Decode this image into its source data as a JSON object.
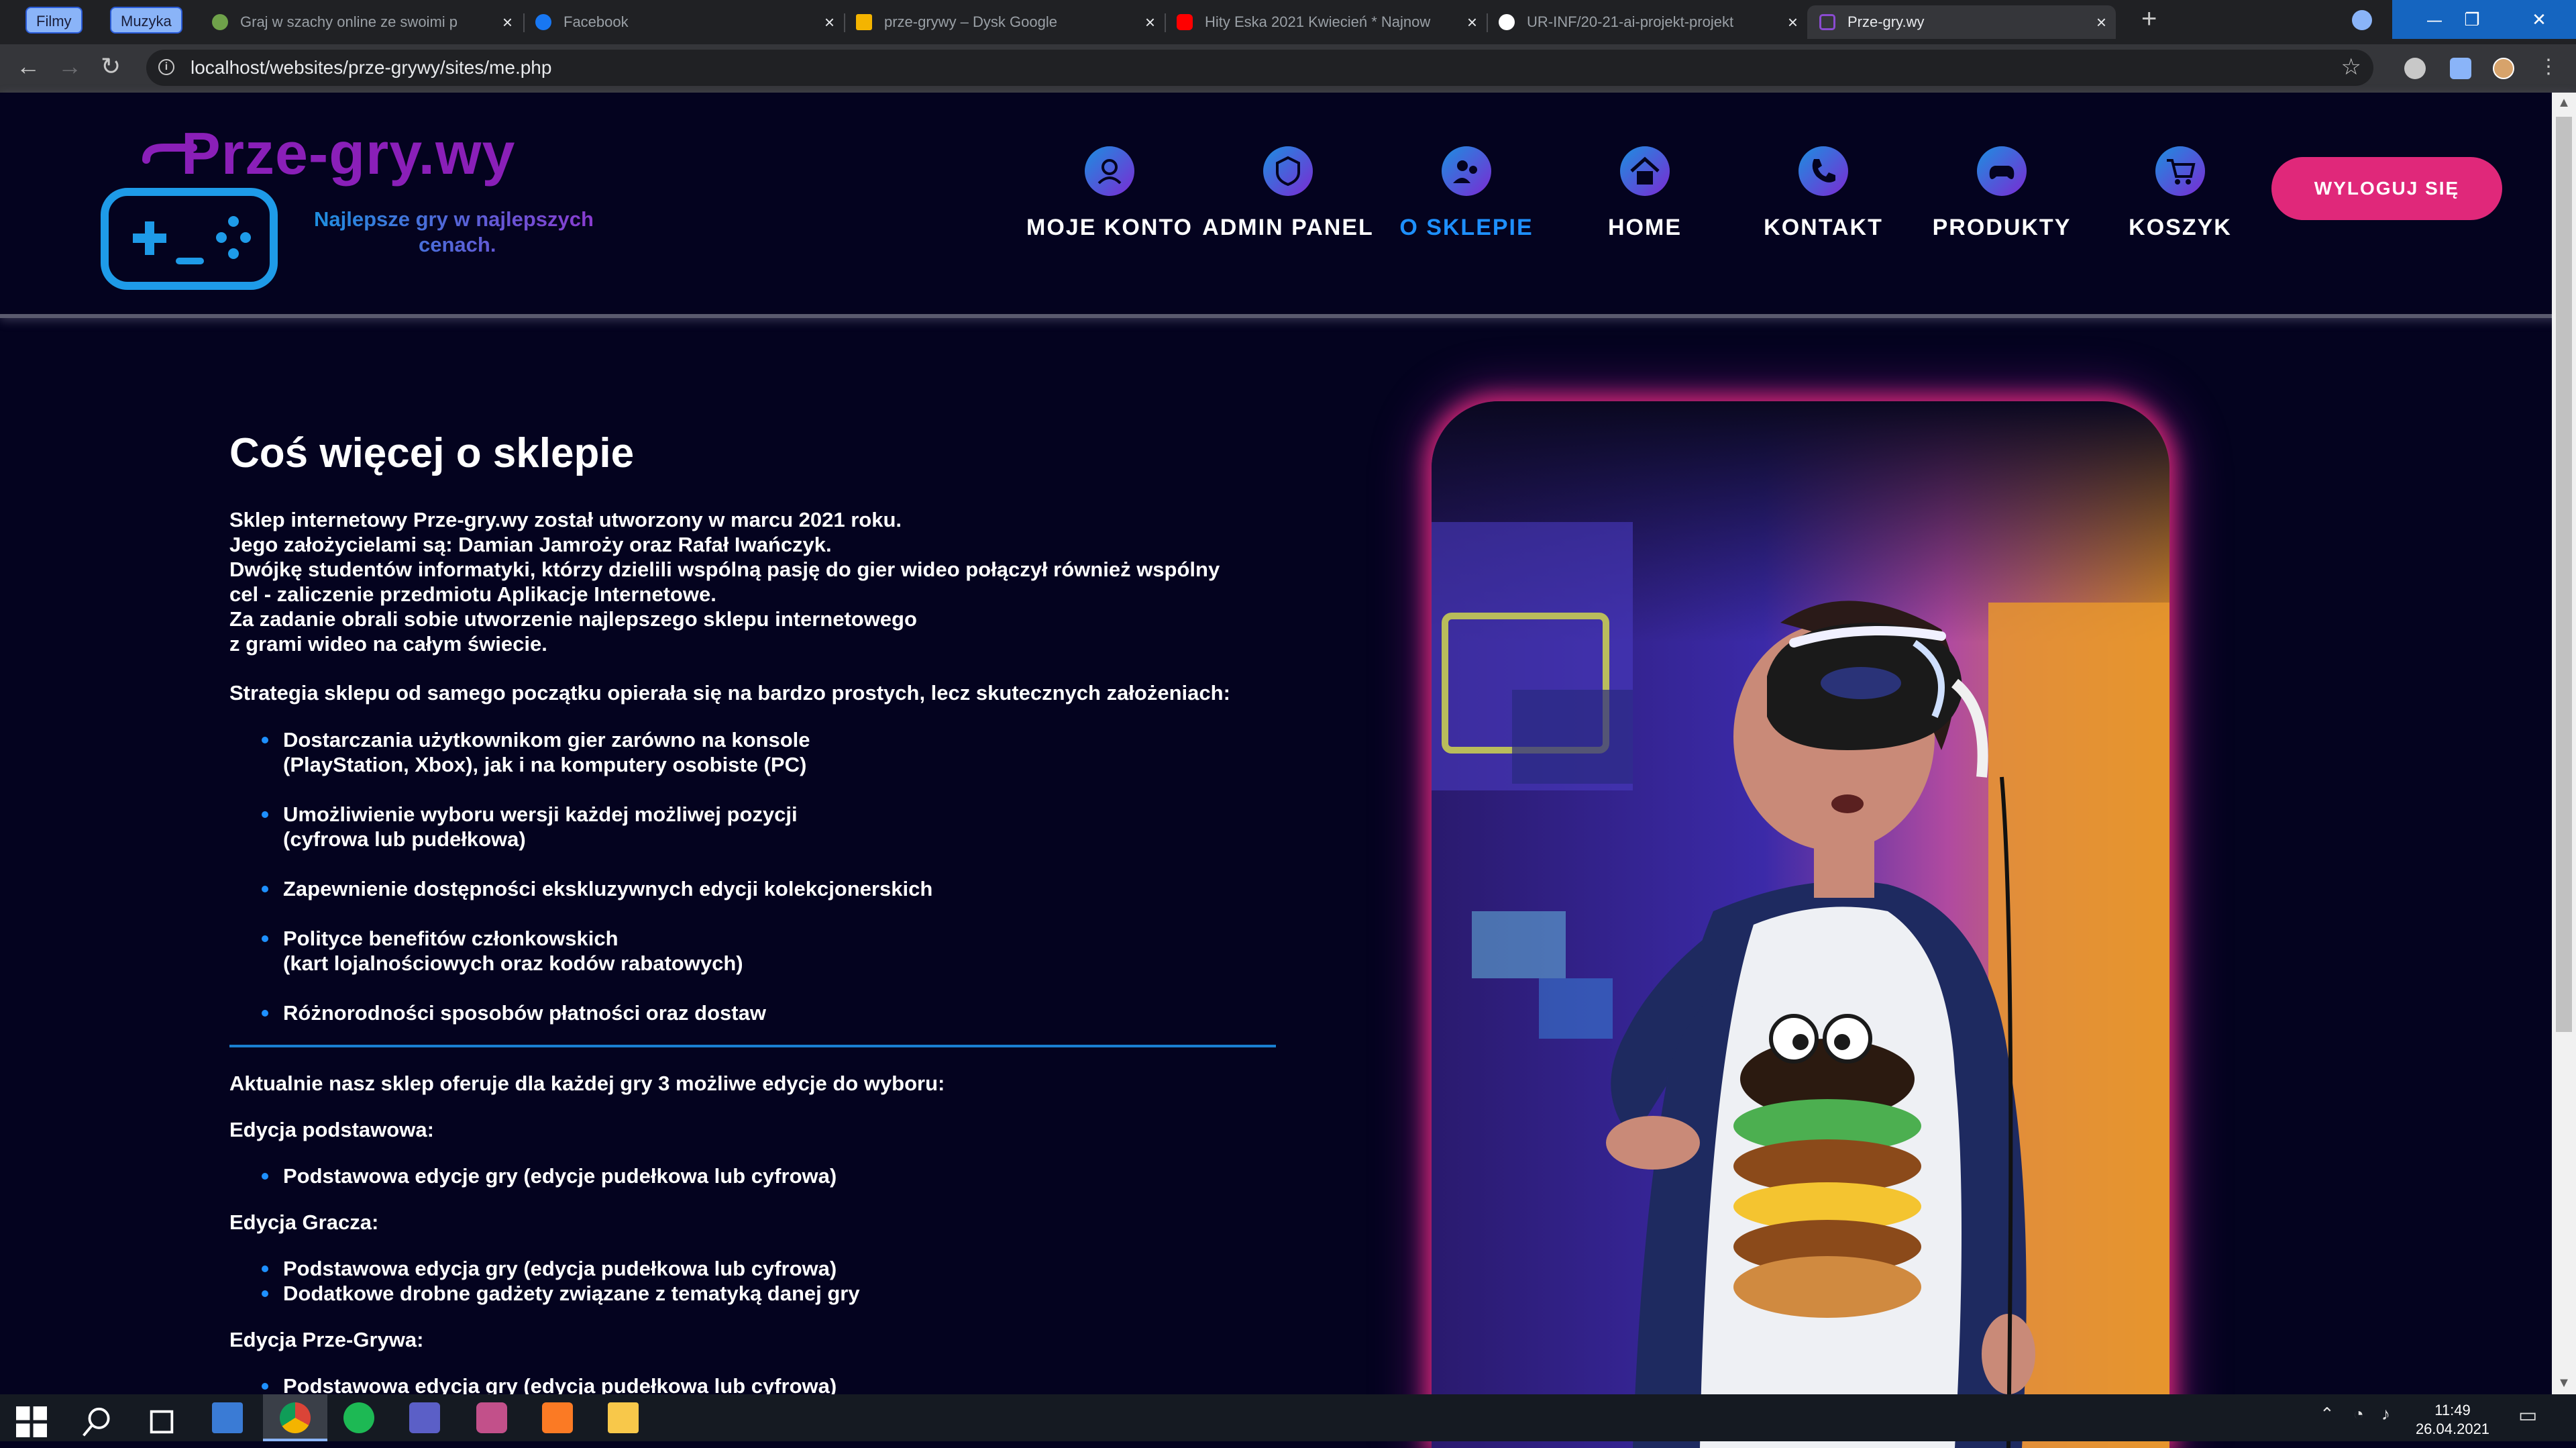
{
  "browser": {
    "bookmarks": [
      "Filmy",
      "Muzyka"
    ],
    "tabs": [
      {
        "title": "Graj w szachy online ze swoimi p",
        "favicon_color": "#6fa24a"
      },
      {
        "title": "Facebook",
        "favicon_color": "#1877f2"
      },
      {
        "title": "prze-grywy – Dysk Google",
        "favicon_color": "#f4b400"
      },
      {
        "title": "Hity Eska 2021 Kwiecień * Najnow",
        "favicon_color": "#ff0000"
      },
      {
        "title": "UR-INF/20-21-ai-projekt-projekt",
        "favicon_color": "#ffffff"
      },
      {
        "title": "Prze-gry.wy",
        "favicon_color": "#8a4bd0"
      }
    ],
    "url": "localhost/websites/prze-grywy/sites/me.php"
  },
  "site": {
    "logo_title": "Prze-gry.wy",
    "tagline_line1": "Najlepsze gry w najlepszych",
    "tagline_line2": "cenach.",
    "nav": [
      {
        "label": "MOJE KONTO",
        "icon": "account-icon"
      },
      {
        "label": "ADMIN PANEL",
        "icon": "admin-icon"
      },
      {
        "label": "O SKLEPIE",
        "icon": "about-icon"
      },
      {
        "label": "HOME",
        "icon": "home-icon"
      },
      {
        "label": "KONTAKT",
        "icon": "phone-icon"
      },
      {
        "label": "PRODUKTY",
        "icon": "gamepad-icon"
      },
      {
        "label": "KOSZYK",
        "icon": "cart-icon"
      }
    ],
    "active_nav": "O SKLEPIE",
    "logout_label": "WYLOGUJ SIĘ",
    "accent_pink": "#e0287a",
    "accent_blue": "#1e90ff"
  },
  "content": {
    "title": "Coś więcej o sklepie",
    "intro": [
      "Sklep internetowy Prze-gry.wy został utworzony w marcu 2021 roku.",
      "Jego założycielami są: Damian Jamroży oraz Rafał Iwańczyk.",
      "Dwójkę studentów informatyki, którzy dzielili wspólną pasję do gier wideo połączył również wspólny",
      "cel - zaliczenie przedmiotu Aplikacje Internetowe.",
      "Za zadanie obrali sobie utworzenie najlepszego sklepu internetowego",
      "z grami wideo na całym świecie."
    ],
    "strategy_heading": "Strategia sklepu od samego początku opierała się na bardzo prostych, lecz skutecznych założeniach:",
    "strategy": [
      [
        "Dostarczania użytkownikom gier zarówno na konsole",
        "(PlayStation, Xbox), jak i na komputery osobiste (PC)"
      ],
      [
        "Umożliwienie wyboru wersji każdej możliwej pozycji",
        "(cyfrowa lub pudełkowa)"
      ],
      [
        "Zapewnienie dostępności ekskluzywnych edycji kolekcjonerskich"
      ],
      [
        "Polityce benefitów członkowskich",
        "(kart lojalnościowych oraz kodów rabatowych)"
      ],
      [
        "Różnorodności sposobów płatności oraz dostaw"
      ]
    ],
    "editions_intro": "Aktualnie nasz sklep oferuje dla każdej gry 3 możliwe edycje do wyboru:",
    "edition1_name": "Edycja podstawowa:",
    "edition1_items": [
      "Podstawowa edycje gry (edycje pudełkowa lub cyfrowa)"
    ],
    "edition2_name": "Edycja Gracza:",
    "edition2_items": [
      "Podstawowa edycja gry (edycja pudełkowa lub cyfrowa)",
      "Dodatkowe drobne gadżety związane z tematyką danej gry"
    ],
    "edition3_name": "Edycja Prze-Grywa:",
    "edition3_items": [
      "Podstawowa edycja gry (edycja pudełkowa lub cyfrowa)"
    ]
  },
  "taskbar": {
    "time": "11:49",
    "date": "26.04.2021"
  }
}
